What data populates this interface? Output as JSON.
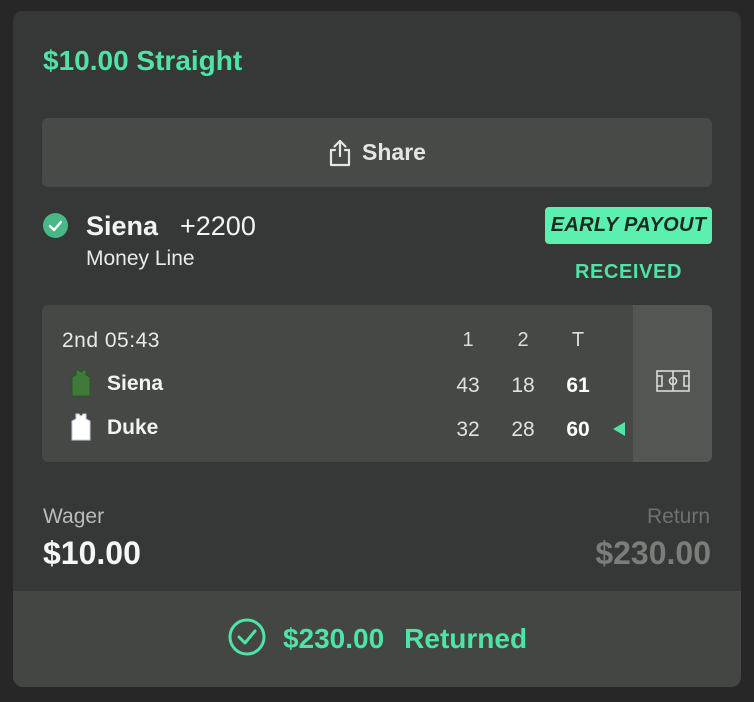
{
  "bet": {
    "title": "$10.00 Straight",
    "share_label": "Share",
    "selection": {
      "team": "Siena",
      "odds": "+2200",
      "market": "Money Line"
    },
    "badges": {
      "early_payout": "EARLY PAYOUT",
      "received": "RECEIVED"
    }
  },
  "scoreboard": {
    "clock": "2nd 05:43",
    "columns": [
      "1",
      "2",
      "T"
    ],
    "teams": [
      {
        "name": "Siena",
        "scores": [
          "43",
          "18",
          "61"
        ],
        "jersey_color": "#3f7a3a"
      },
      {
        "name": "Duke",
        "scores": [
          "32",
          "28",
          "60"
        ],
        "jersey_color": "#ffffff"
      }
    ],
    "possession": "Duke"
  },
  "totals": {
    "wager_label": "Wager",
    "wager_value": "$10.00",
    "return_label": "Return",
    "return_value": "$230.00"
  },
  "result": {
    "amount": "$230.00",
    "status": "Returned"
  },
  "colors": {
    "accent": "#4fe3a6",
    "card": "#353836",
    "badge": "#5cf0b0"
  }
}
